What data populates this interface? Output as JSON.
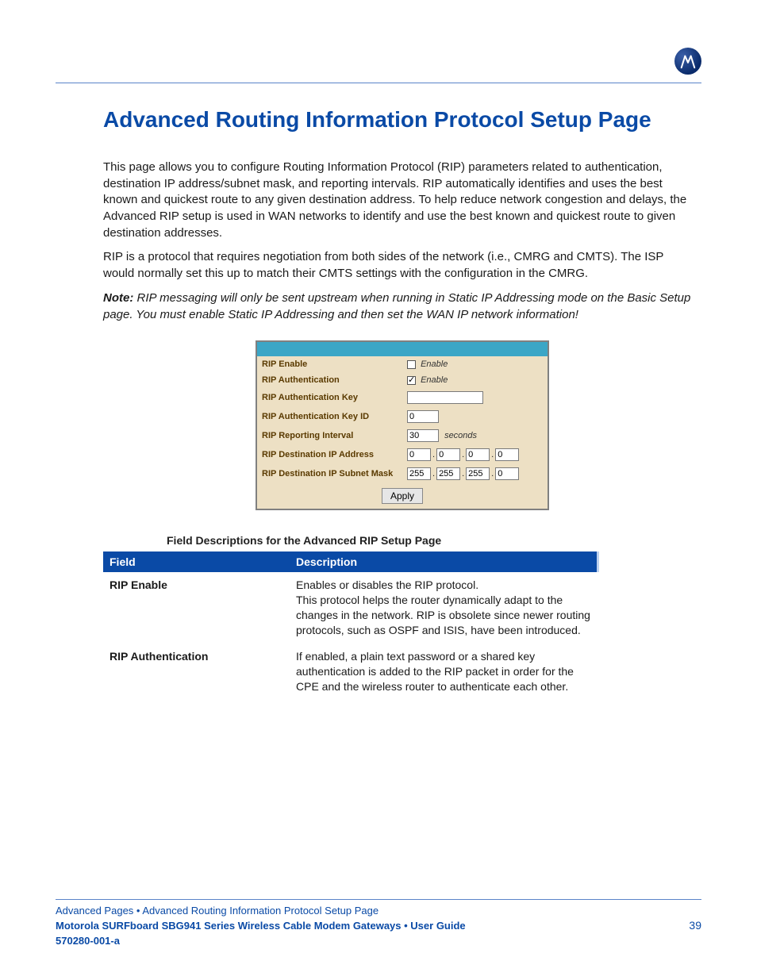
{
  "heading": "Advanced Routing Information Protocol Setup Page",
  "paragraphs": {
    "p1": "This page allows you to configure Routing Information Protocol (RIP) parameters related to authentication, destination IP address/subnet mask, and reporting intervals. RIP automatically identifies and uses the best known and quickest route to any given destination address. To help reduce network congestion and delays, the Advanced RIP setup is used in WAN networks to identify and use the best known and quickest route to given destination addresses.",
    "p2": "RIP is a protocol that requires negotiation from both sides of the network (i.e., CMRG and CMTS). The ISP would normally set this up to match their CMTS settings with the configuration in the CMRG.",
    "note_label": "Note:",
    "note_text": " RIP messaging will only be sent upstream when running in Static IP Addressing mode on the Basic Setup page. You must enable Static IP Addressing and then set the WAN IP network information!"
  },
  "figure": {
    "rows": {
      "rip_enable_label": "RIP Enable",
      "rip_auth_label": "RIP Authentication",
      "rip_auth_key_label": "RIP Authentication Key",
      "rip_auth_key_id_label": "RIP Authentication Key ID",
      "rip_interval_label": "RIP Reporting Interval",
      "rip_dest_ip_label": "RIP Destination IP Address",
      "rip_dest_mask_label": "RIP Destination IP Subnet Mask"
    },
    "values": {
      "enable_text": "Enable",
      "auth_key": "",
      "auth_key_id": "0",
      "interval": "30",
      "interval_unit": "seconds",
      "dest_ip": [
        "0",
        "0",
        "0",
        "0"
      ],
      "dest_mask": [
        "255",
        "255",
        "255",
        "0"
      ],
      "apply_label": "Apply"
    }
  },
  "table_caption": "Field Descriptions for the Advanced RIP Setup Page",
  "table": {
    "head": {
      "field": "Field",
      "desc": "Description"
    },
    "rows": [
      {
        "field": "RIP Enable",
        "desc": "Enables or disables the RIP protocol.\nThis protocol helps the router dynamically adapt to the changes in the network. RIP is obsolete since newer routing protocols, such as OSPF and ISIS, have been introduced."
      },
      {
        "field": "RIP Authentication",
        "desc": "If enabled, a plain text password or a shared key authentication is added to the RIP packet in order for the CPE and the wireless router to authenticate each other."
      }
    ]
  },
  "footer": {
    "crumb": "Advanced Pages • Advanced Routing Information Protocol Setup Page",
    "guide": "Motorola SURFboard SBG941 Series Wireless Cable Modem Gateways • User Guide",
    "page_number": "39",
    "doc_code": "570280-001-a"
  }
}
